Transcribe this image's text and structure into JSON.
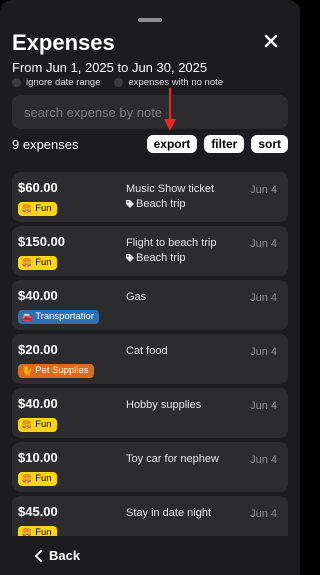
{
  "header": {
    "title": "Expenses",
    "date_range": "From Jun 1, 2025 to Jun 30, 2025"
  },
  "toggles": {
    "ignore_date_range": "ignore date range",
    "no_note": "expenses with no note"
  },
  "search": {
    "placeholder": "search expense by note"
  },
  "summary": {
    "count": "9 expenses"
  },
  "actions": {
    "export": "export",
    "filter": "filter",
    "sort": "sort"
  },
  "expenses": [
    {
      "amount": "$60.00",
      "category": "Fun",
      "category_color": "#ffd60a",
      "note": "Music Show ticket",
      "tag": "Beach trip",
      "date": "Jun 4"
    },
    {
      "amount": "$150.00",
      "category": "Fun",
      "category_color": "#ffd60a",
      "note": "Flight to beach trip",
      "tag": "Beach trip",
      "date": "Jun 4"
    },
    {
      "amount": "$40.00",
      "category": "Transportatior",
      "category_color": "#2f6fb3",
      "note": "Gas",
      "tag": "",
      "date": "Jun 4"
    },
    {
      "amount": "$20.00",
      "category": "Pet Supplies",
      "category_color": "#e06a1c",
      "note": "Cat food",
      "tag": "",
      "date": "Jun 4"
    },
    {
      "amount": "$40.00",
      "category": "Fun",
      "category_color": "#ffd60a",
      "note": "Hobby supplies",
      "tag": "",
      "date": "Jun 4"
    },
    {
      "amount": "$10.00",
      "category": "Fun",
      "category_color": "#ffd60a",
      "note": "Toy car for nephew",
      "tag": "",
      "date": "Jun 4"
    },
    {
      "amount": "$45.00",
      "category": "Fun",
      "category_color": "#ffd60a",
      "note": "Stay in date night",
      "tag": "",
      "date": "Jun 4"
    }
  ],
  "footer": {
    "back": "Back"
  },
  "colors": {
    "background": "#1c1c1e",
    "card": "#2c2c2e",
    "annotation_arrow": "#e8281e"
  }
}
